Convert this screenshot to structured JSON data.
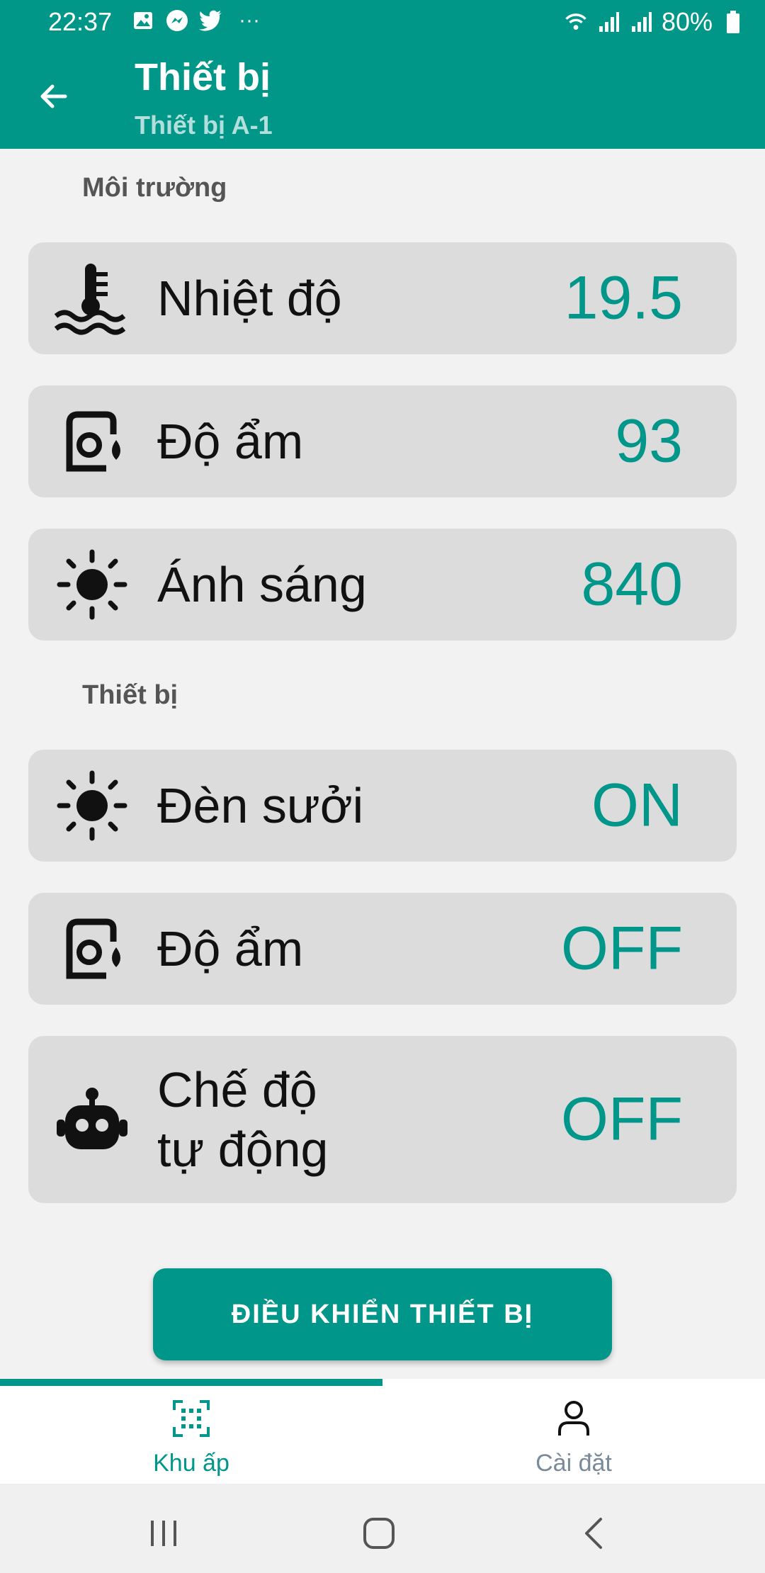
{
  "status_bar": {
    "time": "22:37",
    "more": "···",
    "battery": "80%"
  },
  "header": {
    "title": "Thiết bị",
    "subtitle": "Thiết bị A-1"
  },
  "sections": {
    "environment_title": "Môi trường",
    "devices_title": "Thiết bị"
  },
  "environment": [
    {
      "label": "Nhiệt độ",
      "value": "19.5",
      "icon": "thermometer-water-icon"
    },
    {
      "label": "Độ ẩm",
      "value": "93",
      "icon": "humidity-icon"
    },
    {
      "label": "Ánh sáng",
      "value": "840",
      "icon": "sun-icon"
    }
  ],
  "devices": [
    {
      "label": "Đèn sưởi",
      "value": "ON",
      "icon": "sun-icon"
    },
    {
      "label": "Độ ẩm",
      "value": "OFF",
      "icon": "humidity-icon"
    },
    {
      "label_line1": "Chế độ",
      "label_line2": "tự động",
      "value": "OFF",
      "icon": "robot-icon"
    }
  ],
  "action_button": "ĐIỀU KHIỂN THIẾT BỊ",
  "bottom_nav": [
    {
      "label": "Khu ấp",
      "icon": "grid-scan-icon",
      "active": true
    },
    {
      "label": "Cài đặt",
      "icon": "person-icon",
      "active": false
    }
  ],
  "colors": {
    "accent": "#009688",
    "value": "#00968a",
    "card": "#dcdcdc",
    "inactive_nav": "#7a8a99"
  }
}
